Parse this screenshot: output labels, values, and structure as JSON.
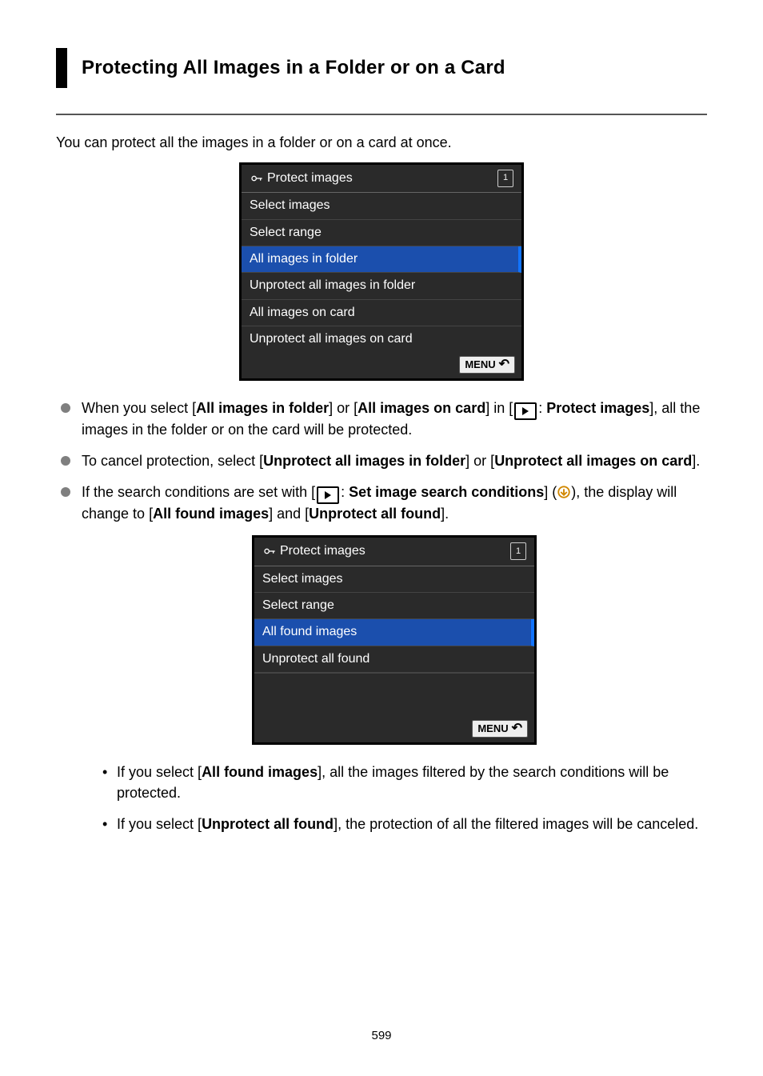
{
  "heading": "Protecting All Images in a Folder or on a Card",
  "intro": "You can protect all the images in a folder or on a card at once.",
  "menu1": {
    "title": "Protect images",
    "cardLabel": "1",
    "items": [
      {
        "label": "Select images",
        "selected": false
      },
      {
        "label": "Select range",
        "selected": false
      },
      {
        "label": "All images in folder",
        "selected": true
      },
      {
        "label": "Unprotect all images in folder",
        "selected": false
      },
      {
        "label": "All images on card",
        "selected": false
      },
      {
        "label": "Unprotect all images on card",
        "selected": false
      }
    ],
    "footerBtn": "MENU"
  },
  "bullet1": {
    "pre": "When you select [",
    "b1": "All images in folder",
    "mid1": "] or [",
    "b2": "All images on card",
    "mid2": "] in [",
    "afterIcon": ": ",
    "b3": "Protect images",
    "post": "], all the images in the folder or on the card will be protected."
  },
  "bullet2": {
    "pre": "To cancel protection, select [",
    "b1": "Unprotect all images in folder",
    "mid": "] or [",
    "b2": "Unprotect all images on card",
    "post": "]."
  },
  "bullet3": {
    "pre": "If the search conditions are set with [",
    "afterIcon": ": ",
    "b1": "Set image search conditions",
    "mid1": "] (",
    "mid2": "), the display will change to [",
    "b2": "All found images",
    "mid3": "] and [",
    "b3": "Unprotect all found",
    "post": "]."
  },
  "menu2": {
    "title": "Protect images",
    "cardLabel": "1",
    "items": [
      {
        "label": "Select images",
        "selected": false
      },
      {
        "label": "Select range",
        "selected": false
      },
      {
        "label": "All found images",
        "selected": true
      },
      {
        "label": "Unprotect all found",
        "selected": false
      }
    ],
    "footerBtn": "MENU"
  },
  "sub1": {
    "pre": "If you select [",
    "b1": "All found images",
    "post": "], all the images filtered by the search conditions will be protected."
  },
  "sub2": {
    "pre": "If you select [",
    "b1": "Unprotect all found",
    "post": "], the protection of all the filtered images will be canceled."
  },
  "pageNumber": "599"
}
